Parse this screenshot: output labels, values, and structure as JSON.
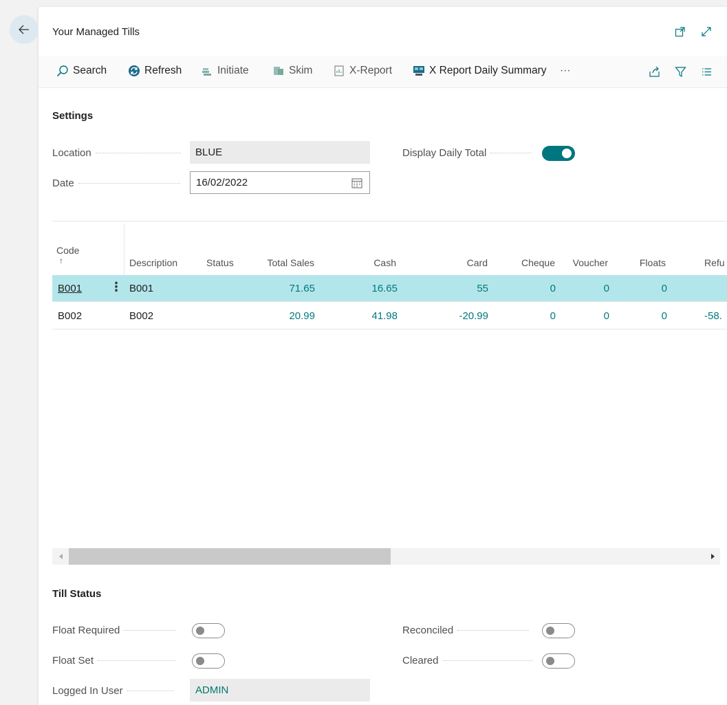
{
  "header": {
    "title": "Your Managed Tills"
  },
  "toolbar": {
    "search": "Search",
    "refresh": "Refresh",
    "initiate": "Initiate",
    "skim": "Skim",
    "xreport": "X-Report",
    "xreport_daily": "X Report Daily Summary",
    "more": "···"
  },
  "settings": {
    "title": "Settings",
    "location_label": "Location",
    "location_value": "BLUE",
    "date_label": "Date",
    "date_value": "16/02/2022",
    "display_daily_total_label": "Display Daily Total",
    "display_daily_total": true
  },
  "grid": {
    "columns": [
      "Code",
      "↑",
      "Description",
      "Status",
      "Total Sales",
      "Cash",
      "Card",
      "Cheque",
      "Voucher",
      "Floats",
      "Refu"
    ],
    "rows": [
      {
        "code": "B001",
        "description": "B001",
        "status": "",
        "total_sales": "71.65",
        "cash": "16.65",
        "card": "55",
        "cheque": "0",
        "voucher": "0",
        "floats": "0",
        "refunds": ""
      },
      {
        "code": "B002",
        "description": "B002",
        "status": "",
        "total_sales": "20.99",
        "cash": "41.98",
        "card": "-20.99",
        "cheque": "0",
        "voucher": "0",
        "floats": "0",
        "refunds": "-58."
      }
    ]
  },
  "till_status": {
    "title": "Till Status",
    "float_required_label": "Float Required",
    "float_required": false,
    "float_set_label": "Float Set",
    "float_set": false,
    "reconciled_label": "Reconciled",
    "reconciled": false,
    "cleared_label": "Cleared",
    "cleared": false,
    "logged_in_user_label": "Logged In User",
    "logged_in_user": "ADMIN"
  },
  "colors": {
    "accent": "#00767e",
    "selected_row": "#b3e6ea",
    "link": "#00797e"
  }
}
